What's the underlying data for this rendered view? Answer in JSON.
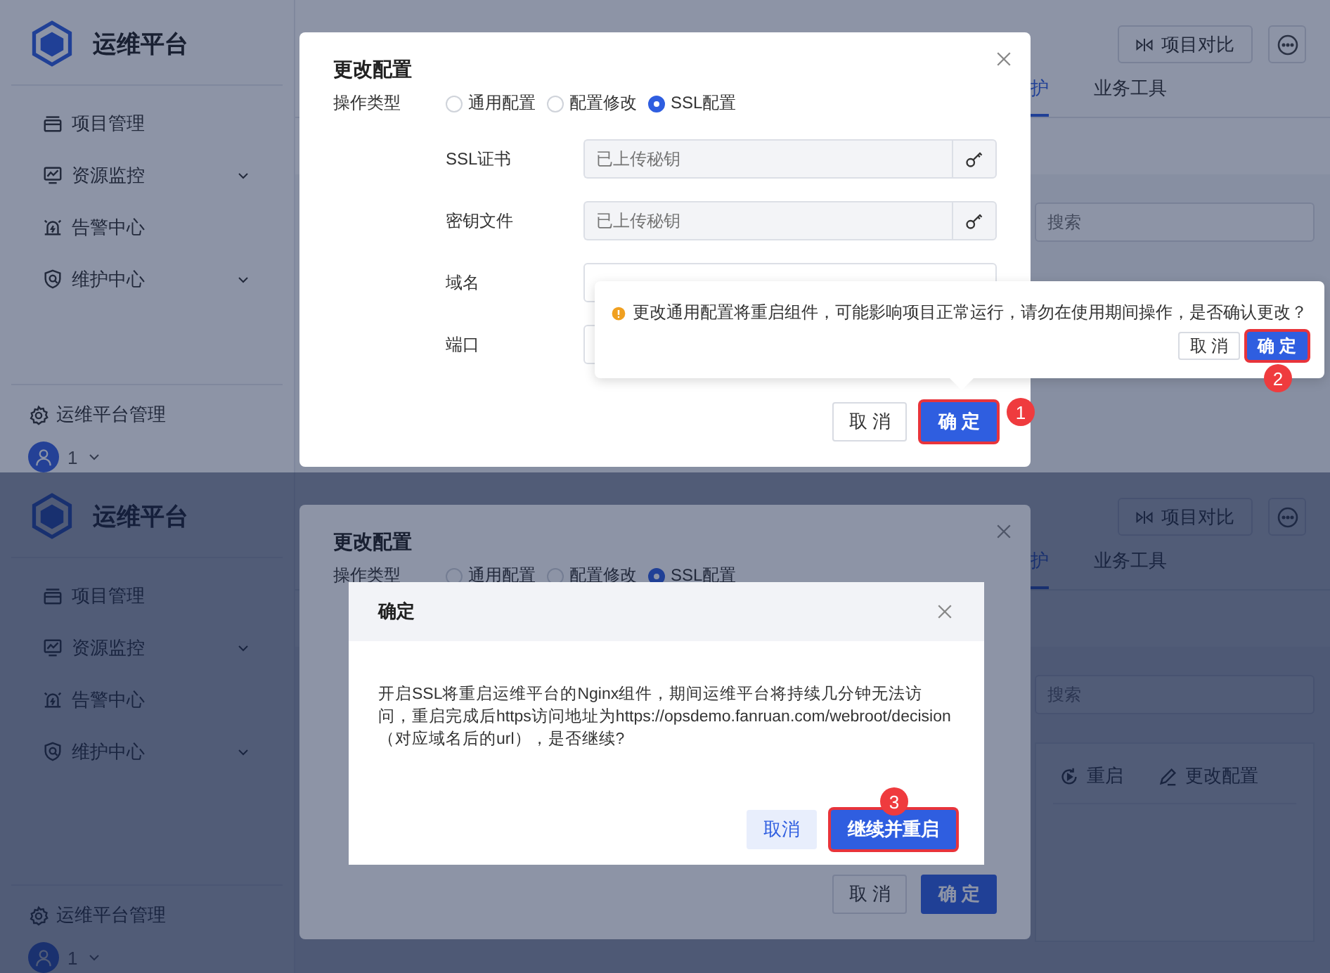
{
  "panels": [
    {
      "sidebar": {
        "title": "运维平台",
        "items": [
          {
            "label": "项目管理",
            "expandable": false
          },
          {
            "label": "资源监控",
            "expandable": true
          },
          {
            "label": "告警中心",
            "expandable": false
          },
          {
            "label": "维护中心",
            "expandable": true
          }
        ],
        "footer": "运维平台管理",
        "user": "1"
      },
      "header": {
        "compare_button": "项目对比"
      },
      "tabs": [
        {
          "label": "护",
          "selected": true
        },
        {
          "label": "业务工具",
          "selected": false
        }
      ],
      "search": {
        "placeholder": "搜索"
      },
      "dialog": {
        "title": "更改配置",
        "dimmed": false,
        "type_label": "操作类型",
        "options": [
          {
            "label": "通用配置",
            "selected": false
          },
          {
            "label": "配置修改",
            "selected": false
          },
          {
            "label": "SSL配置",
            "selected": true
          }
        ],
        "fields": [
          {
            "label": "SSL证书",
            "placeholder": "已上传秘钥",
            "kind": "key"
          },
          {
            "label": "密钥文件",
            "placeholder": "已上传秘钥",
            "kind": "key"
          },
          {
            "label": "域名",
            "kind": "text"
          },
          {
            "label": "端口",
            "kind": "text"
          }
        ],
        "cancel_button": {
          "label": "取 消",
          "highlighted": false
        },
        "ok_button": {
          "label": "确 定",
          "highlighted": true
        },
        "step": "1"
      },
      "popconfirm": {
        "message": "更改通用配置将重启组件，可能影响项目正常运行，请勿在使用期间操作，是否确认更改？",
        "cancel_button": {
          "label": "取 消",
          "highlighted": false
        },
        "ok_button": {
          "label": "确 定",
          "highlighted": true
        },
        "step": "2"
      }
    },
    {
      "sidebar": {
        "title": "运维平台",
        "items": [
          {
            "label": "项目管理",
            "expandable": false
          },
          {
            "label": "资源监控",
            "expandable": true
          },
          {
            "label": "告警中心",
            "expandable": false
          },
          {
            "label": "维护中心",
            "expandable": true
          }
        ],
        "footer": "运维平台管理",
        "user": "1"
      },
      "header": {
        "compare_button": "项目对比"
      },
      "tabs": [
        {
          "label": "护",
          "selected": true
        },
        {
          "label": "业务工具",
          "selected": false
        }
      ],
      "search": {
        "placeholder": "搜索"
      },
      "toolbar": [
        {
          "label": "重启",
          "kind": "restart"
        },
        {
          "label": "更改配置",
          "kind": "edit"
        }
      ],
      "dialog": {
        "title": "更改配置",
        "dimmed": true,
        "type_label": "操作类型",
        "options": [
          {
            "label": "通用配置",
            "selected": false
          },
          {
            "label": "配置修改",
            "selected": false
          },
          {
            "label": "SSL配置",
            "selected": true
          }
        ],
        "cancel_button": {
          "label": "取 消",
          "highlighted": false
        },
        "ok_button": {
          "label": "确 定",
          "highlighted": false
        }
      },
      "confirm_modal": {
        "title": "确定",
        "message": "开启SSL将重启运维平台的Nginx组件，期间运维平台将持续几分钟无法访问，重启完成后https访问地址为https://opsdemo.fanruan.com/webroot/decision（对应域名后的url），是否继续?",
        "cancel_button": {
          "label": "取消",
          "highlighted": false
        },
        "ok_button": {
          "label": "继续并重启",
          "highlighted": true
        },
        "step": "3"
      }
    }
  ]
}
